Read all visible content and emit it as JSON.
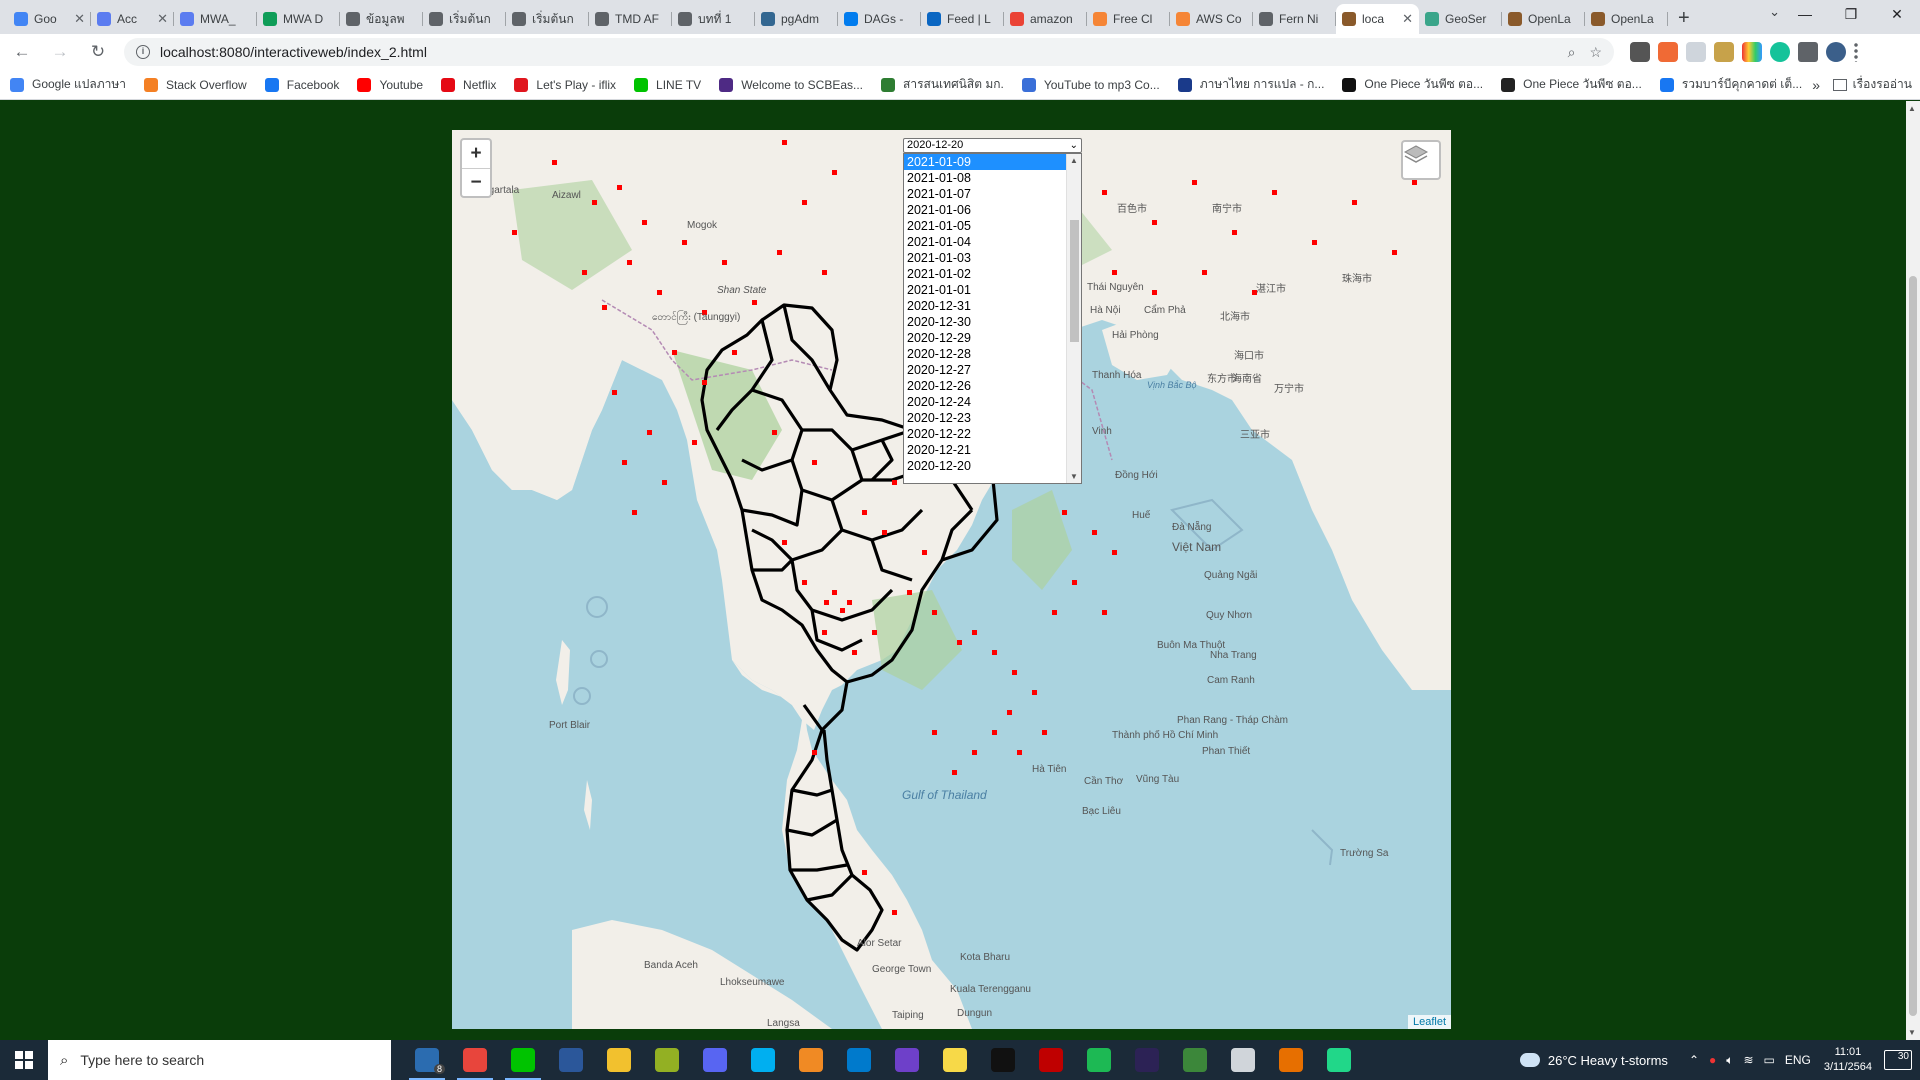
{
  "browser": {
    "tabs": [
      {
        "label": "Goo",
        "icon": "docs-icon",
        "color": "#4285f4"
      },
      {
        "label": "Acc",
        "icon": "generic-site-icon",
        "color": "#5b7cf0"
      },
      {
        "label": "MWA_",
        "icon": "generic-site-icon",
        "color": "#5b7cf0"
      },
      {
        "label": "MWA D",
        "icon": "sheets-icon",
        "color": "#0f9d58"
      },
      {
        "label": "ข้อมูลพ",
        "icon": "globe-icon",
        "color": "#5f6368"
      },
      {
        "label": "เริ่มต้นก",
        "icon": "book-icon",
        "color": "#5f6368"
      },
      {
        "label": "เริ่มต้นก",
        "icon": "book-icon",
        "color": "#5f6368"
      },
      {
        "label": "TMD AF",
        "icon": "globe-icon",
        "color": "#5f6368"
      },
      {
        "label": "บทที่ 1",
        "icon": "globe-icon",
        "color": "#5f6368"
      },
      {
        "label": "pgAdm",
        "icon": "pgadmin-icon",
        "color": "#336791"
      },
      {
        "label": "DAGs -",
        "icon": "airflow-icon",
        "color": "#017cee"
      },
      {
        "label": "Feed | L",
        "icon": "linkedin-icon",
        "color": "#0a66c2"
      },
      {
        "label": "amazon",
        "icon": "google-icon",
        "color": "#ea4335"
      },
      {
        "label": "Free Cl",
        "icon": "aws-icon",
        "color": "#f58536"
      },
      {
        "label": "AWS Co",
        "icon": "aws-icon",
        "color": "#f58536"
      },
      {
        "label": "Fern Ni",
        "icon": "globe-icon",
        "color": "#5f6368"
      },
      {
        "label": "loca",
        "icon": "page-icon",
        "color": "#8a5a2b",
        "active": true
      },
      {
        "label": "GeoSer",
        "icon": "geoserver-icon",
        "color": "#3aa58a"
      },
      {
        "label": "OpenLa",
        "icon": "page-icon",
        "color": "#8a5a2b"
      },
      {
        "label": "OpenLa",
        "icon": "page-icon",
        "color": "#8a5a2b"
      }
    ],
    "url": "localhost:8080/interactiveweb/index_2.html",
    "bookmarks": [
      {
        "label": "Google แปลภาษา",
        "icon": "translate-icon",
        "color": "#4285f4"
      },
      {
        "label": "Stack Overflow",
        "icon": "stackoverflow-icon",
        "color": "#f48024"
      },
      {
        "label": "Facebook",
        "icon": "facebook-icon",
        "color": "#1877f2"
      },
      {
        "label": "Youtube",
        "icon": "youtube-icon",
        "color": "#ff0000"
      },
      {
        "label": "Netflix",
        "icon": "netflix-icon",
        "color": "#e50914"
      },
      {
        "label": "Let's Play - iflix",
        "icon": "iflix-icon",
        "color": "#e0161e"
      },
      {
        "label": "LINE TV",
        "icon": "linetv-icon",
        "color": "#00c300"
      },
      {
        "label": "Welcome to SCBEas...",
        "icon": "scb-icon",
        "color": "#4e2a84"
      },
      {
        "label": "สารสนเทศนิสิต มก.",
        "icon": "ku-icon",
        "color": "#2e7d32"
      },
      {
        "label": "YouTube to mp3 Co...",
        "icon": "converter-icon",
        "color": "#3a6fd8"
      },
      {
        "label": "ภาษาไทย การแปล - ก...",
        "icon": "site-icon",
        "color": "#1a3a8a"
      },
      {
        "label": "One Piece วันพีซ ตอ...",
        "icon": "star-icon",
        "color": "#111111"
      },
      {
        "label": "One Piece วันพีซ ตอ...",
        "icon": "n-icon",
        "color": "#222222"
      },
      {
        "label": "รวมบาร์บีคุกคาดต่ เต็...",
        "icon": "facebook-icon",
        "color": "#1877f2"
      }
    ],
    "bookmarks_more": "»",
    "reading_list": "เรื่องรออ่าน"
  },
  "map": {
    "date_select": {
      "value": "2020-12-20",
      "selected_option": "2021-01-09",
      "options": [
        "2021-01-09",
        "2021-01-08",
        "2021-01-07",
        "2021-01-06",
        "2021-01-05",
        "2021-01-04",
        "2021-01-03",
        "2021-01-02",
        "2021-01-01",
        "2020-12-31",
        "2020-12-30",
        "2020-12-29",
        "2020-12-28",
        "2020-12-27",
        "2020-12-26",
        "2020-12-24",
        "2020-12-23",
        "2020-12-22",
        "2020-12-21",
        "2020-12-20"
      ]
    },
    "zoom_in": "+",
    "zoom_out": "−",
    "attribution": "Leaflet",
    "labels": {
      "aizawl": "Aizawl",
      "agartala": "Agartala",
      "mogok": "Mogok",
      "shan": "Shan State",
      "taunggyi": "တောင်ကြီး (Taunggyi)",
      "port_blair": "Port Blair",
      "ha_noi": "Hà Nội",
      "hai_phong": "Hải Phòng",
      "cam_pha": "Cẩm Phả",
      "vinh": "Vinh",
      "dong_hoi": "Đồng Hới",
      "hue": "Huế",
      "da_nang": "Đà Nẵng",
      "viet_nam": "Việt Nam",
      "quang_ngai": "Quảng Ngãi",
      "quy_nhon": "Quy Nhơn",
      "buon_ma_thuot": "Buôn Ma Thuột",
      "nha_trang": "Nha Trang",
      "cam_ranh": "Cam Ranh",
      "phan_rang": "Phan Rang - Tháp Chàm",
      "phan_thiet": "Phan Thiết",
      "hcmc": "Thành phố Hồ Chí Minh",
      "vung_tau": "Vũng Tàu",
      "can_tho": "Cần Thơ",
      "bac_lieu": "Bạc Liêu",
      "ha_tien": "Hà Tiên",
      "gulf_of_thailand": "Gulf of Thailand",
      "banda_aceh": "Banda Aceh",
      "lhokseumawe": "Lhokseumawe",
      "kota_bharu": "Kota Bharu",
      "george_town": "George Town",
      "alor_setar": "Alor Setar",
      "kuala_terengganu": "Kuala Terengganu",
      "dungun": "Dungun",
      "langsa": "Langsa",
      "truong_sa": "Trường Sa",
      "hainan": "海南省",
      "haikou": "海口市",
      "beihai": "北海市",
      "sanya": "三亚市",
      "zhanjiang": "湛江市",
      "baise": "百色市",
      "nanning": "南宁市",
      "zhuhai": "珠海市",
      "taiping": "Taiping",
      "vinh_bac_bo": "Vịnh Bắc Bộ",
      "dongfang": "东方市",
      "wanning": "万宁市",
      "thai_nguyen": "Thái Nguyên",
      "thanh_hoa": "Thanh Hóa"
    }
  },
  "taskbar": {
    "search_placeholder": "Type here to search",
    "mail_badge": "8",
    "apps": [
      {
        "name": "mail-app-icon",
        "color": "#2b6cb0",
        "running": true
      },
      {
        "name": "chrome-app-icon",
        "color": "#e8453c",
        "running": true
      },
      {
        "name": "line-app-icon",
        "color": "#00c300",
        "running": true
      },
      {
        "name": "word-app-icon",
        "color": "#2b579a",
        "running": false
      },
      {
        "name": "explorer-app-icon",
        "color": "#f2c12e",
        "running": false
      },
      {
        "name": "qgis-app-icon",
        "color": "#93b023",
        "running": false
      },
      {
        "name": "discord-app-icon",
        "color": "#5865f2",
        "running": false
      },
      {
        "name": "skype-app-icon",
        "color": "#00aff0",
        "running": false
      },
      {
        "name": "sublime-app-icon",
        "color": "#f08a24",
        "running": false
      },
      {
        "name": "vscode-app-icon",
        "color": "#007acc",
        "running": false
      },
      {
        "name": "github-app-icon",
        "color": "#6e40c9",
        "running": false
      },
      {
        "name": "sticky-notes-app-icon",
        "color": "#f7d948",
        "running": false
      },
      {
        "name": "terminal-app-icon",
        "color": "#111111",
        "running": false
      },
      {
        "name": "filezilla-app-icon",
        "color": "#bf0000",
        "running": false
      },
      {
        "name": "spotify-app-icon",
        "color": "#1db954",
        "running": false
      },
      {
        "name": "eclipse-app-icon",
        "color": "#2c2255",
        "running": false
      },
      {
        "name": "node-app-icon",
        "color": "#3c873a",
        "running": false
      },
      {
        "name": "calculator-app-icon",
        "color": "#d0d5da",
        "running": false
      },
      {
        "name": "java-app-icon",
        "color": "#e76f00",
        "running": false
      },
      {
        "name": "pycharm-app-icon",
        "color": "#21d789",
        "running": false
      }
    ],
    "weather": "26°C  Heavy t-storms",
    "language": "ENG",
    "time": "11:01",
    "date": "3/11/2564",
    "notifications": "30"
  }
}
